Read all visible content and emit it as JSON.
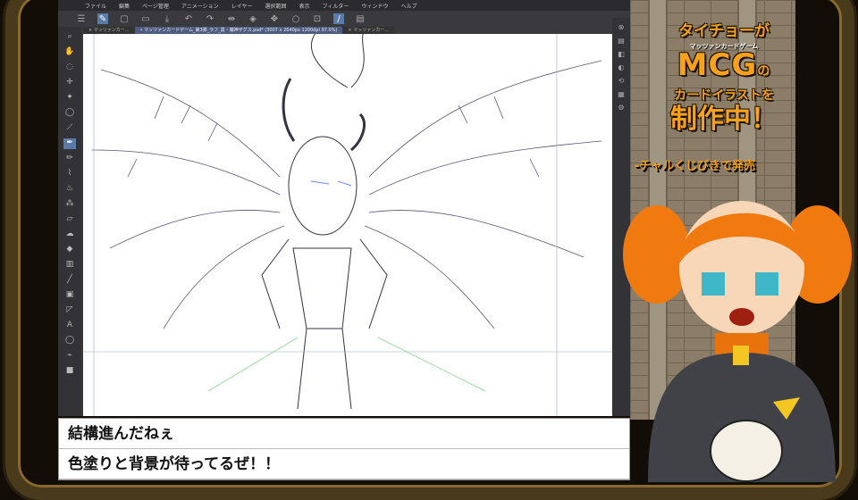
{
  "app": {
    "menu": [
      "ファイル",
      "編集",
      "ページ管理",
      "アニメーション",
      "レイヤー",
      "選択範囲",
      "表示",
      "フィルター",
      "ウィンドウ",
      "ヘルプ"
    ],
    "tabs": [
      {
        "label": "× マッツァンカー..."
      },
      {
        "label": "• マッツァンカードゲーム_第3弾_ラフ_黒・魔神ザグス.psd* (3007 x 2640px 1200dpi 97.0%)"
      },
      {
        "label": "× マッツァンカー..."
      }
    ]
  },
  "promo": {
    "line1": "タイチョーが",
    "ruby": "マッツァンカードゲーム",
    "line2": "MCG",
    "line2_suffix": "の",
    "line3": "カードイラストを",
    "line4": "制作中！",
    "line5": "-チャルくじびきで発売"
  },
  "subtitles": [
    "結構進んだねぇ",
    "色塗りと背景が待ってるぜ！！"
  ],
  "colors": {
    "accent": "#f7a21a",
    "frame": "#4a3a1c",
    "tool_active": "#5a7aa8"
  }
}
